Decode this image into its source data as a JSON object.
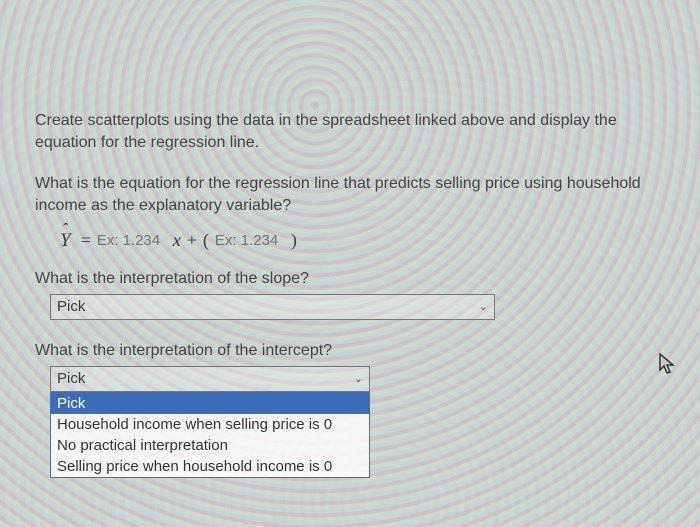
{
  "instruction": "Create scatterplots using the data in the spreadsheet linked above and display the equation for the regression line.",
  "question1": "What is the equation for the regression line that predicts selling price using household income as the explanatory variable?",
  "equation": {
    "yhat": "Y",
    "equals": "=",
    "coef_placeholder": "Ex: 1.234",
    "xvar": "x",
    "plus": "+",
    "lparen": "(",
    "intercept_placeholder": "Ex: 1.234",
    "rparen": ")"
  },
  "question2": {
    "label": "What is the interpretation of the slope?",
    "select_value": "Pick"
  },
  "question3": {
    "label": "What is the interpretation of the intercept?",
    "select_value": "Pick",
    "options": [
      "Pick",
      "Household income when selling price is 0",
      "No practical interpretation",
      "Selling price when household income is 0"
    ]
  }
}
